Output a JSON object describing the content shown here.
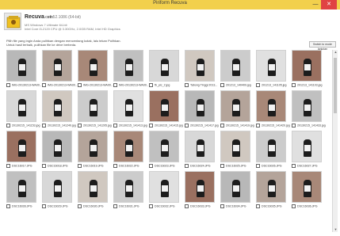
{
  "window": {
    "title": "Piriform Recuva",
    "minimize_glyph": "—",
    "close_glyph": "✕"
  },
  "header": {
    "app_name": "Recuva",
    "app_suffix": ".com",
    "version": "v1.52.1086 (64-bit)",
    "os_line": "MS Windows 7 Ultimate 64-bit",
    "cpu_line": "Intel Core i3-2120 CPU @ 3.30GHz, 2.0GB RAM, Intel HD Graphics"
  },
  "instructions": {
    "line1": "Pilih file yang ingin Anda pulihkan dengan mencentang kotak, lalu tekan Pulihkan.",
    "line2": "Untuk hasil terbaik, pulihkan file ke drive berbeda."
  },
  "switch_button_label": "Switch to mode lanjutan",
  "files": [
    "IMG-20130213-WA00...",
    "IMG-20130213-WA00...",
    "IMG-20130213-WA00...",
    "IMG-20130213-WA00...",
    "fb_pic_2.jpg",
    "Tabong Tinggi 2013...",
    "201213_140409.jpg",
    "201213_141105.jpg",
    "201213_141103.jpg",
    "20130215_141153.jpg",
    "20130215_141249.jpg",
    "20130215_141205.jpg",
    "20130215_141413.jpg",
    "20130215_141415.jpg",
    "20130215_141417.jpg",
    "20130215_141419.jpg",
    "20130215_141420.jpg",
    "20130215_141433.jpg",
    "DSC16017.JPG",
    "DSC16018.JPG",
    "DSC16019.JPG",
    "DSC16022.JPG",
    "DSC16023.JPG",
    "DSC16024.JPG",
    "DSC16025.JPG",
    "DSC16026.JPG",
    "DSC16027.JPG",
    "DSC16028.JPG",
    "DSC16029.JPG",
    "DSC16030.JPG",
    "DSC16031.JPG",
    "DSC16032.JPG",
    "DSC16033.JPG",
    "DSC16034.JPG",
    "DSC16035.JPG",
    "DSC16036.JPG"
  ],
  "colors": {
    "titlebar": "#f2d04c",
    "close_button": "#e04343"
  }
}
